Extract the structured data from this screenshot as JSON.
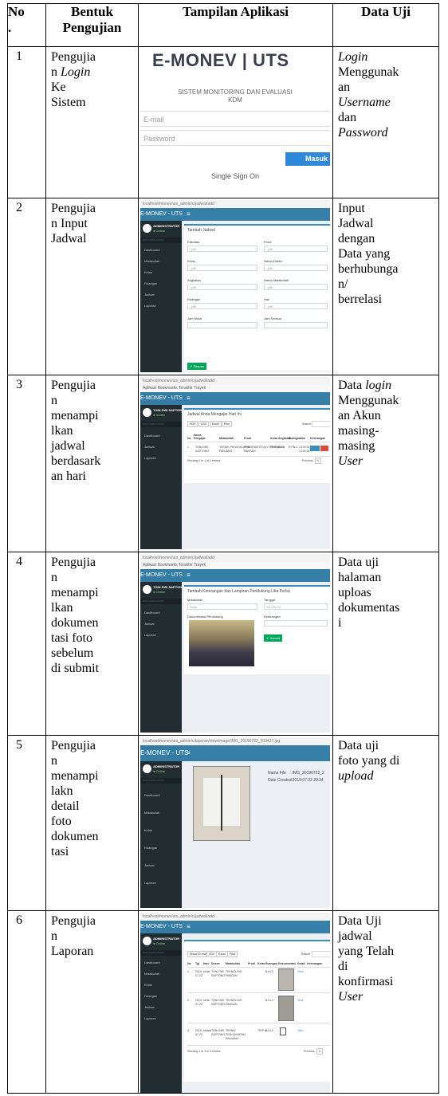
{
  "headers": {
    "no": "No\n.",
    "form": "Bentuk Pengujian",
    "app": "Tampilan Aplikasi",
    "data": "Data Uji"
  },
  "rows": [
    {
      "no": "1",
      "form": "Pengujia\nn ",
      "form_it": "Login",
      "form2": "\nKe\nSistem",
      "data_html": "<i>Login</i>\nMenggunak\nan\n<i>Username</i>\ndan\n<i>Password</i>"
    },
    {
      "no": "2",
      "form": "Pengujia\nn Input\nJadwal",
      "data_html": "Input\nJadwal\ndengan\nData yang\nberhubunga\nn/\nberrelasi"
    },
    {
      "no": "3",
      "form": "Pengujia\nn\nmenampi\nlkan\njadwal\nberdasark\nan hari",
      "data_html": "Data <i>login</i>\nMenggunak\nan Akun\nmasing-\nmasing\n<i>User</i>"
    },
    {
      "no": "4",
      "form": "Pengujia\nn\nmenampi\nlkan\ndokumen\ntasi foto\nsebelum\ndi submit",
      "data_html": "Data uji\nhalaman\nuploas\ndokumentas\ni"
    },
    {
      "no": "5",
      "form": "Pengujia\nn\nmenampi\nlakn\ndetail\nfoto\ndokumen\ntasi",
      "data_html": "Data uji\nfoto yang di\n<i>upload</i>"
    },
    {
      "no": "6",
      "form": "Pengujia\nn\nLaporan",
      "data_html": "Data Uji\njadwal\nyang Telah\ndi\nkonfirmasi\n<i>User</i>"
    }
  ],
  "login_shot": {
    "brand": "E-MONEV | UTS",
    "subtitle": "SISTEM MONITORING DAN EVALUASI\nKDM",
    "email_placeholder": "E-mail",
    "password_placeholder": "Password",
    "submit": "Masuk",
    "sso": "Single Sign On"
  },
  "admin": {
    "logo": "E-MONEV - UTS",
    "menu": "≡",
    "user_name": "ADMINISTRATOR",
    "user_name_teacher": "TONI DWI SAPTONO",
    "user_status": "● Online",
    "nav_header": "MAIN NAVIGATION",
    "nav": [
      "Dashboard",
      "Matakuliah",
      "Kelas",
      "Ruangan",
      "Jadwal",
      "Laporan"
    ],
    "nav_teacher": [
      "Dashboard",
      "Jadwal",
      "Laporan"
    ]
  },
  "shot2": {
    "title": "Tambah Jadwal",
    "labels": [
      "Fakultas",
      "Prodi",
      "Kelas",
      "Nama Dosen",
      "Angkatan",
      "Nama Matakuliah",
      "Ruangan",
      "Hari",
      "Jam Mulai",
      "Jam Selesai"
    ],
    "placeholder": "- pilih -",
    "save": "✔ Simpan"
  },
  "shot3": {
    "title": "Jadwal Anda Mengajar Hari Ini",
    "buttons": [
      "PDF",
      "CSV",
      "Excel",
      "Print"
    ],
    "search": "Search:",
    "cols": [
      "No",
      "Nama Pengajar",
      "Matakuliah",
      "Prodi",
      "Kelas",
      "Angkatan",
      "Ruangan",
      "Jam",
      "Keterangan"
    ],
    "row": [
      "1",
      "TONI DWI\nSAPTONO",
      "TEKNIK PENGUKURAN\nPANJANG",
      "PROGRAM STUDI TEKNOLOGI\nPANGAN",
      "TIHP-A",
      "2016",
      "R.PB-C",
      "13:00:00\n14:00:00"
    ],
    "footer": "Showing 1 to 1 of 1 entries",
    "prev": "Previous",
    "page": "1"
  },
  "shot4": {
    "title": "Tambah Keterangan dan Lampiran Pendukung Lika Perlu)",
    "labels": [
      "Matakuliah",
      "Tanggal",
      "Dokumentasi Pendukung",
      "Keterangan"
    ],
    "values": [
      "Kimia",
      "2019-07-22"
    ],
    "submit": "✔ Submit"
  },
  "shot5": {
    "url": "localhost/monev/uts_admin/c/laporan/view/image/IMG_20190722_203437.jpg",
    "file_label": "Nama File",
    "file_value": ": IMG_20190722_2",
    "date_label": "Date Created",
    "date_value": ": 2019:07:22 20:34"
  },
  "shot6": {
    "buttons": [
      "Show 10 rows",
      "CSV",
      "Excel",
      "Print"
    ],
    "search": "Search:",
    "cols": [
      "No",
      "Tgl",
      "Hari",
      "Dosen",
      "Matakuliah",
      "Prodi",
      "Kelas",
      "Ruangan",
      "Dokumentasi",
      "Detail",
      "Keterangan"
    ],
    "rows": [
      [
        "1",
        "2019-\n07-22",
        "senin",
        "TONI DWI\nSAPTONO",
        "TEKNOLOGI\nPANGAN",
        "",
        "",
        "B.KL3"
      ],
      [
        "2",
        "2019-\n07-22",
        "senin",
        "TONI DWI\nSAPTONO",
        "TEKNOLOGI\nPANGAN",
        "",
        "",
        "B.KL3"
      ],
      [
        "3",
        "2019-\n07-22",
        "selasa",
        "TONI DWI\nSAPTONO",
        "TEKNIK\nPENGUKURAN\nPANJANG",
        "",
        "TIHP-A",
        "B.KL3"
      ]
    ],
    "footer": "Showing 1 to 3 of 3 entries",
    "prev": "Previous",
    "page": "1",
    "view": "View"
  },
  "url_common": "localhost/monev/uts_admin/c/jadwal/add",
  "bookmarks": "Aplikasi  Bookmarks  Terakhir  Trayek"
}
